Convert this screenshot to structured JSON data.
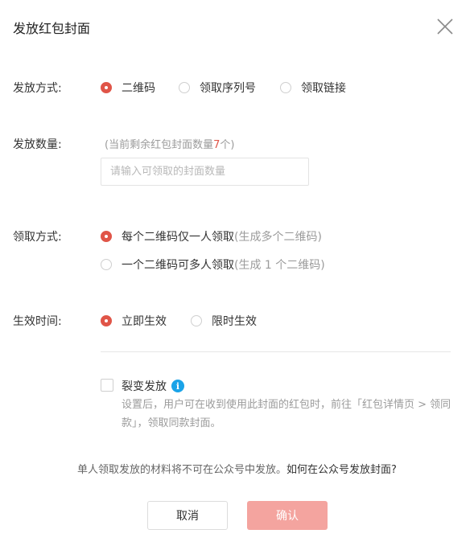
{
  "dialog": {
    "title": "发放红包封面",
    "close_icon": "close-icon"
  },
  "method": {
    "label": "发放方式:",
    "options": [
      "二维码",
      "领取序列号",
      "领取链接"
    ],
    "selected": "二维码"
  },
  "quantity": {
    "label": "发放数量:",
    "hint_prefix": "(当前剩余红包封面数量",
    "hint_count": "7",
    "hint_suffix": "个)",
    "placeholder": "请输入可领取的封面数量",
    "value": ""
  },
  "claim": {
    "label": "领取方式:",
    "option1_label": "每个二维码仅一人领取",
    "option1_note": "(生成多个二维码)",
    "option2_label": "一个二维码可多人领取",
    "option2_note": "(生成 1 个二维码)",
    "selected": "每个二维码仅一人领取"
  },
  "effective": {
    "label": "生效时间:",
    "options": [
      "立即生效",
      "限时生效"
    ],
    "selected": "立即生效"
  },
  "fission": {
    "label": "裂变发放",
    "checked": false,
    "info_icon": "info-icon",
    "info_glyph": "i",
    "description": "设置后，用户可在收到使用此封面的红包时，前往「红包详情页 > 领同款」，领取同款封面。"
  },
  "footer": {
    "note": "单人领取发放的材料将不可在公众号中发放。",
    "link": "如何在公众号发放封面?",
    "cancel_label": "取消",
    "confirm_label": "确认"
  },
  "colors": {
    "accent": "#e05548",
    "confirm_disabled": "#f4a49f",
    "info": "#1aa3e8"
  }
}
